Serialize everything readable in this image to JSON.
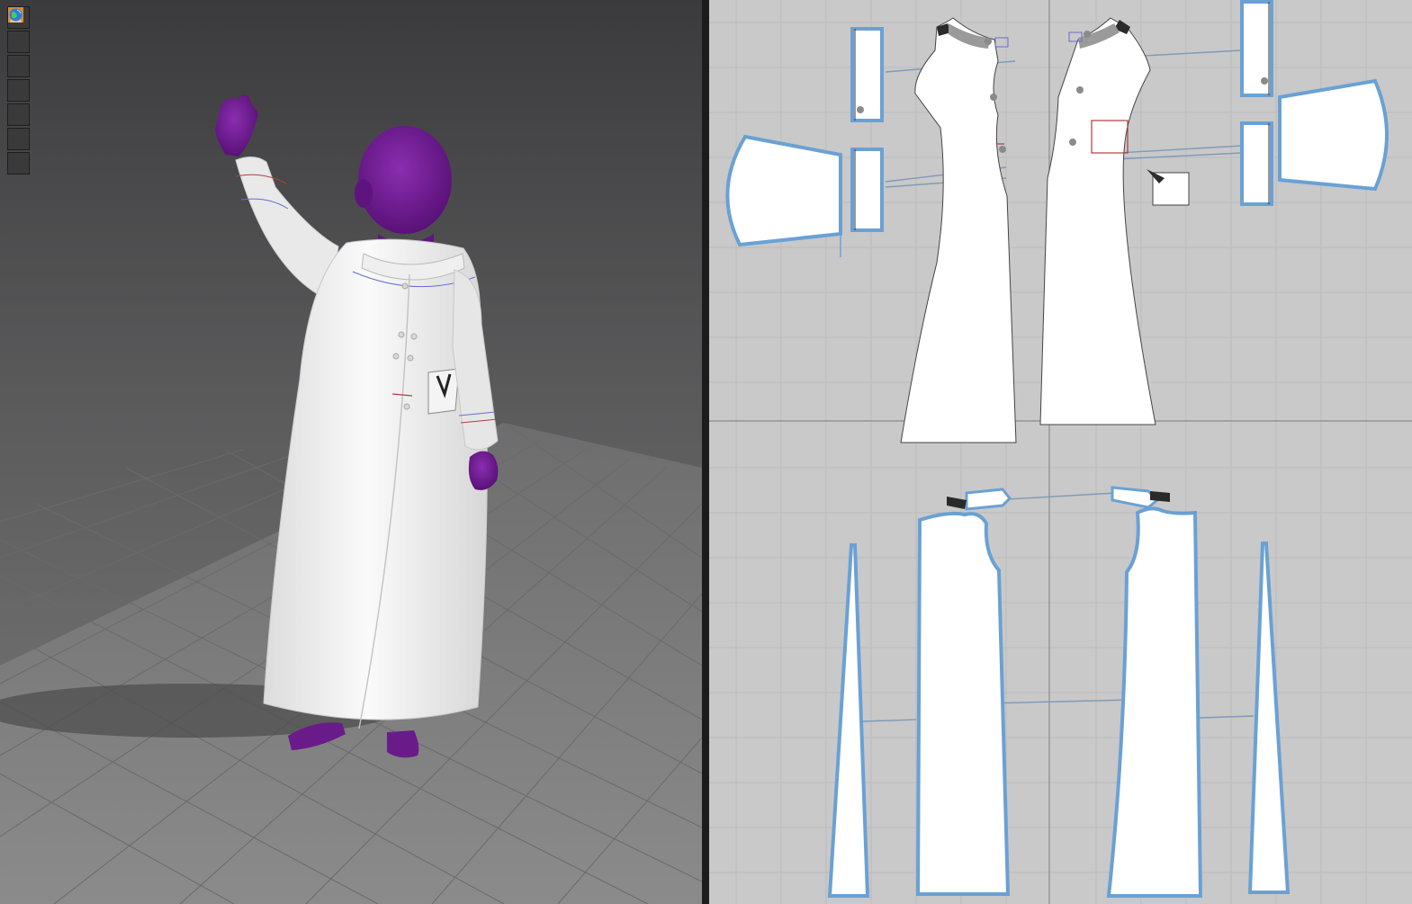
{
  "toolbar": {
    "items": [
      {
        "icon": "garment-icon"
      },
      {
        "icon": "particle-simulation-icon"
      },
      {
        "icon": "avatar-silhouette-icon"
      },
      {
        "icon": "fabric-pattern-icon"
      },
      {
        "icon": "edit-pattern-icon"
      },
      {
        "icon": "avatar-skin-icon"
      },
      {
        "icon": "globe-icon"
      }
    ]
  },
  "colors": {
    "viewport_3d_top": "#3b3b3d",
    "viewport_3d_bottom": "#7a7a7a",
    "viewport_2d_bg": "#c9c9c9",
    "garment_fill": "#ffffff",
    "avatar_skin": "#6b1b8c",
    "selection_outline": "#6aa1d4",
    "seam_line": "#7e9ab8",
    "pocket_outline": "#b23a3a"
  }
}
